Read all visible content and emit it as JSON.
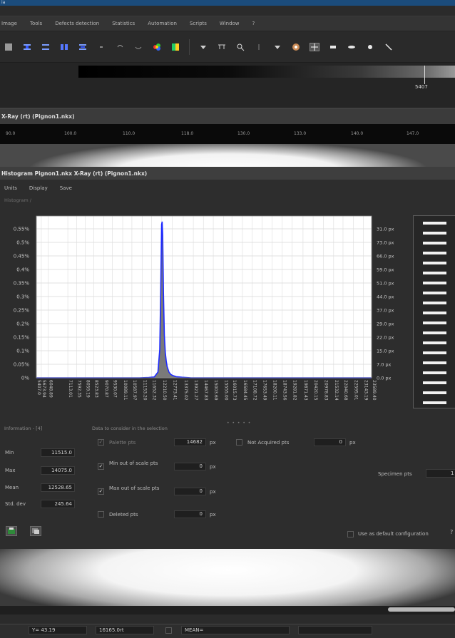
{
  "window": {
    "title_fragment": "ia"
  },
  "menubar": {
    "items": [
      "Image",
      "Tools",
      "Defects detection",
      "Statistics",
      "Automation",
      "Scripts",
      "Window",
      "?"
    ]
  },
  "toolbar": {
    "icons": [
      "grid-icon",
      "align-left-icon",
      "align-center-icon",
      "columns-icon",
      "align-right-icon",
      "dot-icon",
      "undo-icon",
      "redo-icon",
      "color-palette-icon",
      "color-map-icon",
      "dropdown-arrow-icon",
      "ruler-icon",
      "magnifier-icon",
      "separator-icon",
      "dropdown-arrow-icon",
      "paint-icon",
      "pointer-icon",
      "rectangle-tool-icon",
      "ellipse-tool-icon",
      "point-tool-icon",
      "line-tool-icon"
    ],
    "active_tool": "pointer-icon"
  },
  "gradient": {
    "max_value": "5407"
  },
  "xray": {
    "title": "X-Ray (rt) (Pignon1.nkx)",
    "ruler_labels": [
      "90.0",
      "100.0",
      "110.0",
      "118.0",
      "130.0",
      "133.0",
      "140.0",
      "147.0"
    ]
  },
  "histogram": {
    "title": "Histogram Pignon1.nkx X-Ray (rt) (Pignon1.nkx)",
    "menu": [
      "Units",
      "Display",
      "Save"
    ],
    "breadcrumb": "Histogram /"
  },
  "chart_data": {
    "type": "area",
    "y_left_ticks": [
      "0.55%",
      "0.5%",
      "0.45%",
      "0.4%",
      "0.35%",
      "0.3%",
      "0.25%",
      "0.2%",
      "0.15%",
      "0.1%",
      "0.05%",
      "0%"
    ],
    "y_right_ticks": [
      "31.0 px",
      "73.0 px",
      "66.0 px",
      "59.0 px",
      "51.0 px",
      "44.0 px",
      "37.0 px",
      "29.0 px",
      "22.0 px",
      "15.0 px",
      "7.0 px",
      "0.0 px"
    ],
    "x_ticks": [
      "5407.0",
      "5673.94",
      "6048.89",
      "7113.01",
      "7592.35",
      "8059.19",
      "8523.83",
      "9070.87",
      "9530.07",
      "10089.11",
      "10587.97",
      "11153.20",
      "11652.32",
      "12210.50",
      "12773.41",
      "13375.02",
      "13921.27",
      "14467.83",
      "15003.69",
      "15555.00",
      "16015.73",
      "16584.45",
      "17108.72",
      "17653.49",
      "18200.11",
      "18743.56",
      "19281.82",
      "19871.43",
      "20420.15",
      "20978.83",
      "21532.14",
      "22040.68",
      "22595.01",
      "23143.19",
      "23589.40"
    ],
    "ylim": [
      0,
      0.57
    ],
    "peak": {
      "value": 12210.5,
      "percent": 0.55
    },
    "series": [
      {
        "color": "#1e2bff",
        "fill": "#7a7a7a",
        "points": [
          [
            5407,
            0
          ],
          [
            11000,
            0
          ],
          [
            11500,
            0.001
          ],
          [
            11800,
            0.003
          ],
          [
            12000,
            0.02
          ],
          [
            12100,
            0.1
          ],
          [
            12150,
            0.3
          ],
          [
            12200,
            0.54
          ],
          [
            12230,
            0.55
          ],
          [
            12260,
            0.5
          ],
          [
            12300,
            0.3
          ],
          [
            12350,
            0.15
          ],
          [
            12400,
            0.09
          ],
          [
            12450,
            0.06
          ],
          [
            12500,
            0.04
          ],
          [
            12600,
            0.02
          ],
          [
            12700,
            0.012
          ],
          [
            12800,
            0.008
          ],
          [
            13000,
            0.004
          ],
          [
            13300,
            0.002
          ],
          [
            13800,
            0
          ],
          [
            23589,
            0
          ]
        ]
      }
    ]
  },
  "legend": {
    "rows": 19
  },
  "info": {
    "label": "Information - [4]",
    "rows": [
      {
        "key": "Min",
        "value": "11515.0"
      },
      {
        "key": "Max",
        "value": "14075.0"
      },
      {
        "key": "Mean",
        "value": "12528.65"
      },
      {
        "key": "Std. dev",
        "value": "245.64"
      }
    ]
  },
  "selection": {
    "label": "Data to consider in the selection",
    "rows": [
      {
        "label": "Palette pts",
        "checked": true,
        "disabled": true,
        "value": "14682",
        "unit": "px"
      },
      {
        "label": "Min out of scale pts",
        "checked": true,
        "disabled": false,
        "value": "0",
        "unit": "px"
      },
      {
        "label": "Max out of scale pts",
        "checked": true,
        "disabled": false,
        "value": "0",
        "unit": "px"
      },
      {
        "label": "Deleted pts",
        "checked": false,
        "disabled": false,
        "value": "0",
        "unit": "px"
      }
    ],
    "not_acquired": {
      "label": "Not Acquired pts",
      "value": "0",
      "unit": "px"
    },
    "specimen": {
      "label": "Specimen pts",
      "value": "1"
    }
  },
  "config": {
    "default_label": "Use as default configuration",
    "edge_glyph": "?"
  },
  "status": {
    "y": "Y= 43.19",
    "value": "16165.0rt",
    "mean": "MEAN="
  }
}
